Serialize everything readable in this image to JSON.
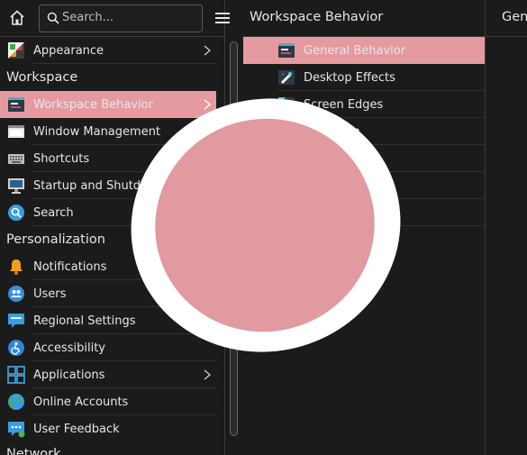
{
  "search": {
    "placeholder": "Search..."
  },
  "sidebar": {
    "items": [
      {
        "label": "Appearance",
        "icon": "appearance-icon",
        "has_children": true
      },
      {
        "category": "Workspace"
      },
      {
        "label": "Workspace Behavior",
        "icon": "workspace-behavior-icon",
        "active": true,
        "has_children": true
      },
      {
        "label": "Window Management",
        "icon": "window-management-icon"
      },
      {
        "label": "Shortcuts",
        "icon": "keyboard-icon"
      },
      {
        "label": "Startup and Shutdown",
        "icon": "monitor-icon"
      },
      {
        "label": "Search",
        "icon": "search-settings-icon"
      },
      {
        "category": "Personalization"
      },
      {
        "label": "Notifications",
        "icon": "bell-icon"
      },
      {
        "label": "Users",
        "icon": "users-icon"
      },
      {
        "label": "Regional Settings",
        "icon": "regional-settings-icon"
      },
      {
        "label": "Accessibility",
        "icon": "accessibility-icon"
      },
      {
        "label": "Applications",
        "icon": "applications-icon",
        "has_children": true
      },
      {
        "label": "Online Accounts",
        "icon": "globe-icon"
      },
      {
        "label": "User Feedback",
        "icon": "feedback-icon"
      },
      {
        "category": "Network"
      }
    ]
  },
  "subpanel": {
    "title": "Workspace Behavior",
    "items": [
      {
        "label": "General Behavior",
        "active": true
      },
      {
        "label": "Desktop Effects"
      },
      {
        "label": "Screen Edges"
      },
      {
        "label": "Screen"
      },
      {
        "label": "king"
      },
      {
        "label": "ps"
      },
      {
        "label": ""
      }
    ]
  },
  "detail": {
    "title": "Gen"
  },
  "colors": {
    "selection": "#e59aa0",
    "background": "#1b1b1b",
    "overlay_fill": "#e19aa0"
  }
}
